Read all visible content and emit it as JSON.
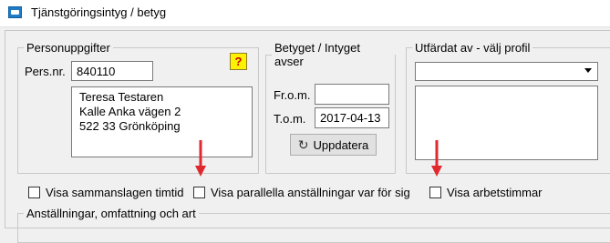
{
  "window": {
    "title": "Tjänstgöringsintyg / betyg"
  },
  "personuppgifter": {
    "legend": "Personuppgifter",
    "persnr_label": "Pers.nr.",
    "persnr_value": "840110",
    "address": "Teresa Testaren\nKalle Anka vägen 2\n522 33 Grönköping",
    "help_label": "?"
  },
  "betyget": {
    "legend": "Betyget / Intyget avser",
    "from_label": "Fr.o.m.",
    "from_value": "",
    "tom_label": "T.o.m.",
    "tom_value": "2017-04-13",
    "update_label": "Uppdatera"
  },
  "utfardat": {
    "legend": "Utfärdat av - välj profil",
    "selected": ""
  },
  "options": {
    "sammanslagen": "Visa sammanslagen timtid",
    "parallella": "Visa parallella anställningar var för sig",
    "arbetstimmar": "Visa arbetstimmar"
  },
  "anstallningar": {
    "legend": "Anställningar, omfattning och art"
  },
  "colors": {
    "annotation_arrow": "#e0282e",
    "help_button": "#fff200"
  }
}
